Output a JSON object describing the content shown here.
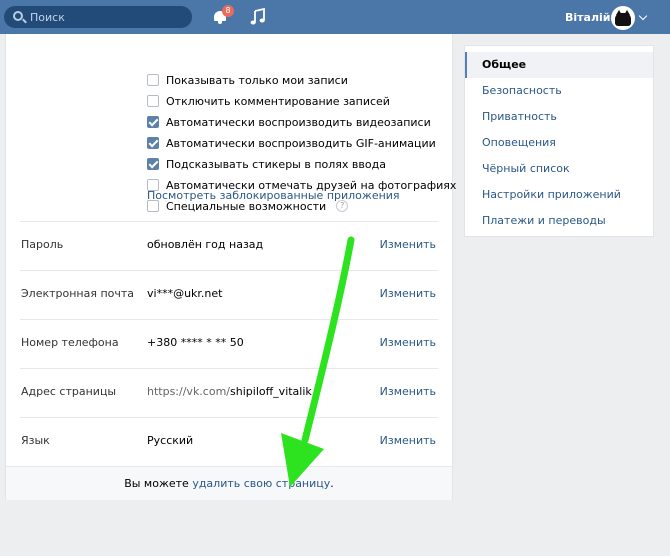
{
  "header": {
    "search_placeholder": "Поиск",
    "notification_count": "8",
    "user_name": "Віталій"
  },
  "privacy_options": [
    {
      "label": "Показывать только мои записи",
      "checked": false
    },
    {
      "label": "Отключить комментирование записей",
      "checked": false
    },
    {
      "label": "Автоматически воспроизводить видеозаписи",
      "checked": true
    },
    {
      "label": "Автоматически воспроизводить GIF-анимации",
      "checked": true
    },
    {
      "label": "Подсказывать стикеры в полях ввода",
      "checked": true
    },
    {
      "label": "Автоматически отмечать друзей на фотографиях",
      "checked": false
    },
    {
      "label": "Специальные возможности",
      "checked": false
    }
  ],
  "help_glyph": "?",
  "blocked_apps_link": "Посмотреть заблокированные приложения",
  "settings_rows": [
    {
      "label": "Пароль",
      "value": "обновлён год назад",
      "action": "Изменить"
    },
    {
      "label": "Электронная почта",
      "value": "vi***@ukr.net",
      "action": "Изменить"
    },
    {
      "label": "Номер телефона",
      "value": "+380 **** * ** 50",
      "action": "Изменить"
    },
    {
      "label": "Адрес страницы",
      "value_prefix": "https://vk.com/",
      "value": "shipiloff_vitalik",
      "action": "Изменить"
    },
    {
      "label": "Язык",
      "value": "Русский",
      "action": "Изменить"
    }
  ],
  "footer": {
    "text_before": "Вы можете ",
    "link": "удалить свою страницу",
    "text_after": "."
  },
  "menu": {
    "items": [
      {
        "label": "Общее",
        "active": true
      },
      {
        "label": "Безопасность",
        "active": false
      },
      {
        "label": "Приватность",
        "active": false
      },
      {
        "label": "Оповещения",
        "active": false
      },
      {
        "label": "Чёрный список",
        "active": false
      },
      {
        "label": "Настройки приложений",
        "active": false
      },
      {
        "label": "Платежи и переводы",
        "active": false
      }
    ]
  },
  "colors": {
    "header": "#4a76a8",
    "link": "#2a5885",
    "annotation_arrow": "#2de31f"
  }
}
